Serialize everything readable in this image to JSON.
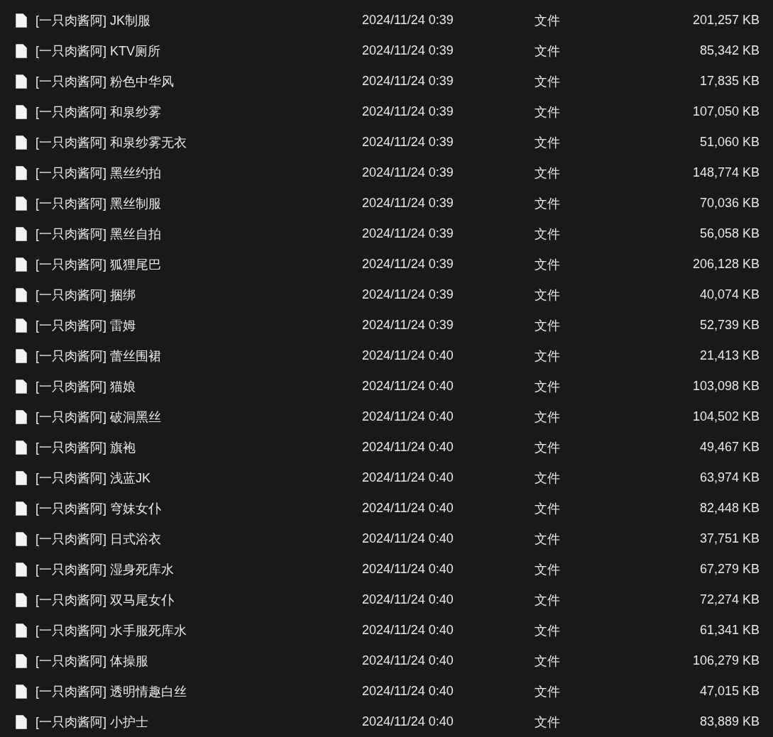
{
  "files": [
    {
      "name": "[一只肉酱阿] JK制服",
      "modified": "2024/11/24 0:39",
      "type": "文件",
      "size": "201,257 KB"
    },
    {
      "name": "[一只肉酱阿] KTV厕所",
      "modified": "2024/11/24 0:39",
      "type": "文件",
      "size": "85,342 KB"
    },
    {
      "name": "[一只肉酱阿] 粉色中华风",
      "modified": "2024/11/24 0:39",
      "type": "文件",
      "size": "17,835 KB"
    },
    {
      "name": "[一只肉酱阿] 和泉纱雾",
      "modified": "2024/11/24 0:39",
      "type": "文件",
      "size": "107,050 KB"
    },
    {
      "name": "[一只肉酱阿] 和泉纱雾无衣",
      "modified": "2024/11/24 0:39",
      "type": "文件",
      "size": "51,060 KB"
    },
    {
      "name": "[一只肉酱阿] 黑丝约拍",
      "modified": "2024/11/24 0:39",
      "type": "文件",
      "size": "148,774 KB"
    },
    {
      "name": "[一只肉酱阿] 黑丝制服",
      "modified": "2024/11/24 0:39",
      "type": "文件",
      "size": "70,036 KB"
    },
    {
      "name": "[一只肉酱阿] 黑丝自拍",
      "modified": "2024/11/24 0:39",
      "type": "文件",
      "size": "56,058 KB"
    },
    {
      "name": "[一只肉酱阿] 狐狸尾巴",
      "modified": "2024/11/24 0:39",
      "type": "文件",
      "size": "206,128 KB"
    },
    {
      "name": "[一只肉酱阿] 捆绑",
      "modified": "2024/11/24 0:39",
      "type": "文件",
      "size": "40,074 KB"
    },
    {
      "name": "[一只肉酱阿] 雷姆",
      "modified": "2024/11/24 0:39",
      "type": "文件",
      "size": "52,739 KB"
    },
    {
      "name": "[一只肉酱阿] 蕾丝围裙",
      "modified": "2024/11/24 0:40",
      "type": "文件",
      "size": "21,413 KB"
    },
    {
      "name": "[一只肉酱阿] 猫娘",
      "modified": "2024/11/24 0:40",
      "type": "文件",
      "size": "103,098 KB"
    },
    {
      "name": "[一只肉酱阿] 破洞黑丝",
      "modified": "2024/11/24 0:40",
      "type": "文件",
      "size": "104,502 KB"
    },
    {
      "name": "[一只肉酱阿] 旗袍",
      "modified": "2024/11/24 0:40",
      "type": "文件",
      "size": "49,467 KB"
    },
    {
      "name": "[一只肉酱阿] 浅蓝JK",
      "modified": "2024/11/24 0:40",
      "type": "文件",
      "size": "63,974 KB"
    },
    {
      "name": "[一只肉酱阿] 穹妹女仆",
      "modified": "2024/11/24 0:40",
      "type": "文件",
      "size": "82,448 KB"
    },
    {
      "name": "[一只肉酱阿] 日式浴衣",
      "modified": "2024/11/24 0:40",
      "type": "文件",
      "size": "37,751 KB"
    },
    {
      "name": "[一只肉酱阿] 湿身死库水",
      "modified": "2024/11/24 0:40",
      "type": "文件",
      "size": "67,279 KB"
    },
    {
      "name": "[一只肉酱阿] 双马尾女仆",
      "modified": "2024/11/24 0:40",
      "type": "文件",
      "size": "72,274 KB"
    },
    {
      "name": "[一只肉酱阿] 水手服死库水",
      "modified": "2024/11/24 0:40",
      "type": "文件",
      "size": "61,341 KB"
    },
    {
      "name": "[一只肉酱阿] 体操服",
      "modified": "2024/11/24 0:40",
      "type": "文件",
      "size": "106,279 KB"
    },
    {
      "name": "[一只肉酱阿] 透明情趣白丝",
      "modified": "2024/11/24 0:40",
      "type": "文件",
      "size": "47,015 KB"
    },
    {
      "name": "[一只肉酱阿] 小护士",
      "modified": "2024/11/24 0:40",
      "type": "文件",
      "size": "83,889 KB"
    }
  ]
}
